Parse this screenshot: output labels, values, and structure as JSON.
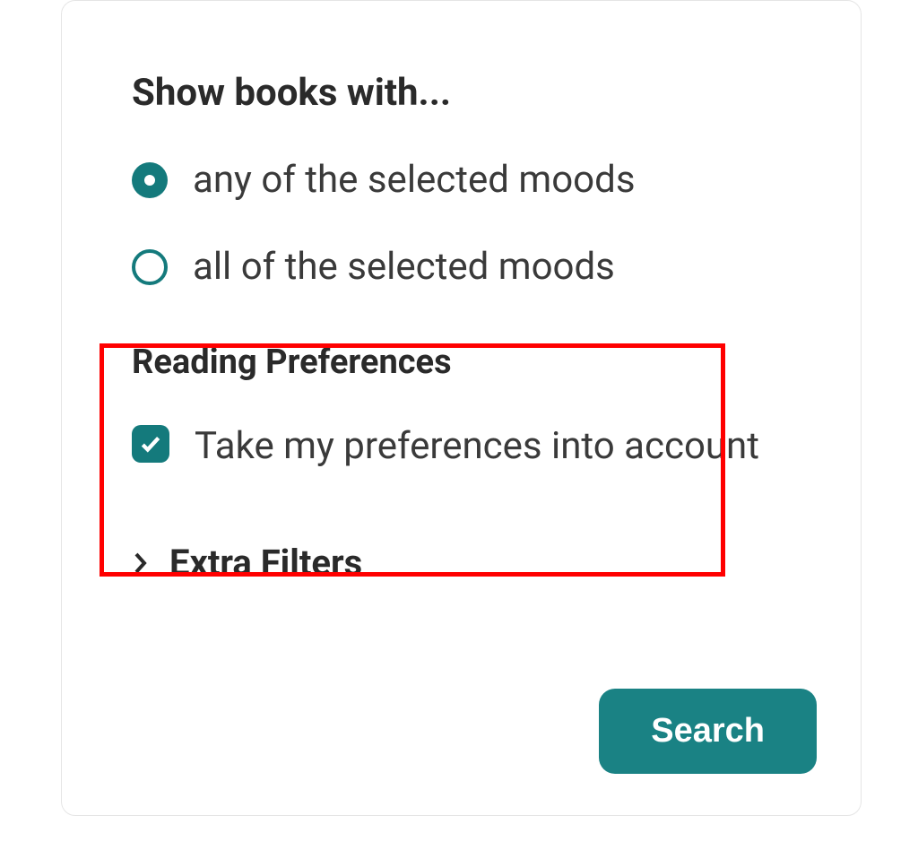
{
  "moods": {
    "title": "Show books with...",
    "options": {
      "any": "any of the selected moods",
      "all": "all of the selected moods"
    },
    "selected": "any"
  },
  "preferences": {
    "title": "Reading Preferences",
    "checkbox_label": "Take my preferences into account",
    "checked": true
  },
  "extra_filters": {
    "label": "Extra Filters"
  },
  "search": {
    "label": "Search"
  },
  "colors": {
    "accent": "#147a7c",
    "highlight_border": "#ff0000"
  }
}
